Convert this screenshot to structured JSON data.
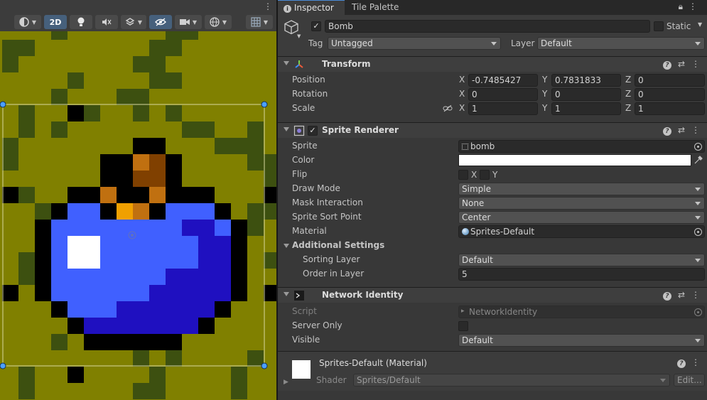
{
  "scene": {
    "toolbar": {
      "btn_2d": "2D",
      "more_icon": "⋮",
      "icons": [
        "draw-mode-icon",
        "lighting-icon",
        "audio-mute-icon",
        "effects-icon",
        "hidden-objects-icon",
        "camera-icon",
        "gizmo-globe-icon",
        "grid-snap-icon"
      ]
    }
  },
  "inspector": {
    "tabs": [
      {
        "label": "Inspector",
        "icon": "info-icon"
      },
      {
        "label": "Tile Palette"
      }
    ],
    "object": {
      "name": "Bomb",
      "active": true,
      "static_label": "Static",
      "static": false,
      "tag_label": "Tag",
      "tag": "Untagged",
      "layer_label": "Layer",
      "layer": "Default"
    },
    "transform": {
      "title": "Transform",
      "position_label": "Position",
      "rotation_label": "Rotation",
      "scale_label": "Scale",
      "position": {
        "x": "-0.7485427",
        "y": "0.7831833",
        "z": "0"
      },
      "rotation": {
        "x": "0",
        "y": "0",
        "z": "0"
      },
      "scale": {
        "x": "1",
        "y": "1",
        "z": "1"
      },
      "axis_x": "X",
      "axis_y": "Y",
      "axis_z": "Z"
    },
    "sprite_renderer": {
      "title": "Sprite Renderer",
      "enabled": true,
      "sprite_label": "Sprite",
      "sprite": "bomb",
      "color_label": "Color",
      "color": "#ffffff",
      "flip_label": "Flip",
      "flip_x_label": "X",
      "flip_y_label": "Y",
      "flip_x": false,
      "flip_y": false,
      "draw_mode_label": "Draw Mode",
      "draw_mode": "Simple",
      "mask_label": "Mask Interaction",
      "mask": "None",
      "sort_point_label": "Sprite Sort Point",
      "sort_point": "Center",
      "material_label": "Material",
      "material": "Sprites-Default",
      "additional_label": "Additional Settings",
      "sorting_layer_label": "Sorting Layer",
      "sorting_layer": "Default",
      "order_label": "Order in Layer",
      "order": "5"
    },
    "network_identity": {
      "title": "Network Identity",
      "script_label": "Script",
      "script": "NetworkIdentity",
      "server_only_label": "Server Only",
      "server_only": false,
      "visible_label": "Visible",
      "visible": "Default"
    },
    "material": {
      "title": "Sprites-Default (Material)",
      "shader_label": "Shader",
      "shader": "Sprites/Default",
      "edit_label": "Edit..."
    }
  },
  "colors": {
    "accent": "#4a8ad6",
    "bg_olive": "#808000",
    "dark_olive": "#3d5010",
    "bomb_light_blue": "#4060ff",
    "bomb_dark_blue": "#1f10c0",
    "fuse_orange": "#c07010",
    "fuse_bright": "#f0a000",
    "fuse_brown": "#804000"
  }
}
